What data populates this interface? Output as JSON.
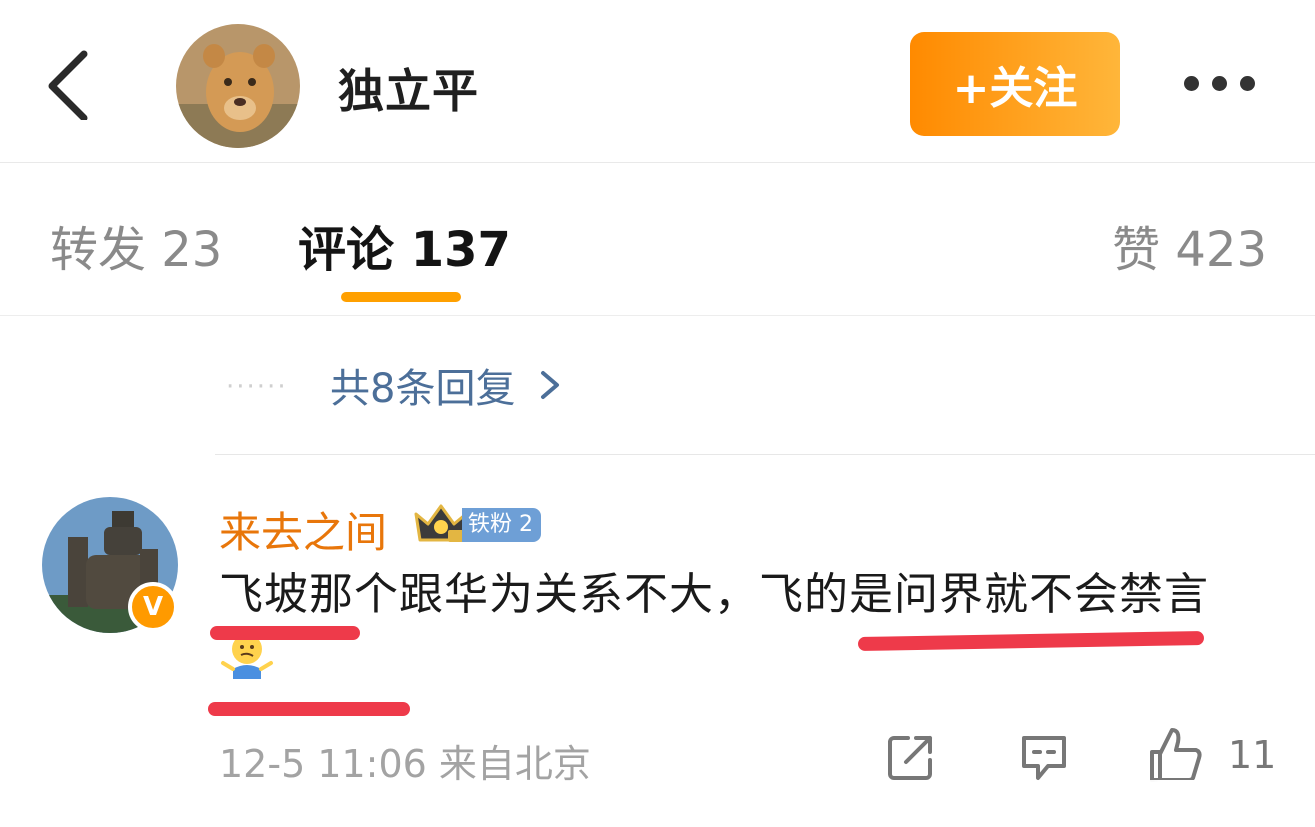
{
  "header": {
    "back_icon": "chevron-left-icon",
    "username": "独立平",
    "follow_label": "+关注",
    "more_icon": "more-dots-icon",
    "accent_color": "#ff9500"
  },
  "tabs": {
    "forward": "转发 23",
    "comments": "评论 137",
    "likes": "赞 423",
    "active": "comments",
    "indicator_color": "#ffa000"
  },
  "replies": {
    "dots": "······",
    "label": "共8条回复",
    "chevron_icon": "chevron-right-icon"
  },
  "comment": {
    "username": "来去之间",
    "badges": [
      "crown-icon",
      "铁粉 2"
    ],
    "fan_badge": "铁粉 2",
    "verified_icon": "v-verified-icon",
    "text_part1": "飞坡那个跟华为关系不大，飞的是问界就不会禁言",
    "emoji": "shrug-emoji-icon",
    "time_location": "12-5 11:06 来自北京",
    "share_icon": "share-icon",
    "comment_icon": "comment-icon",
    "like_icon": "thumbs-up-icon",
    "like_count": "11",
    "underline_color": "#ee3a4a"
  }
}
